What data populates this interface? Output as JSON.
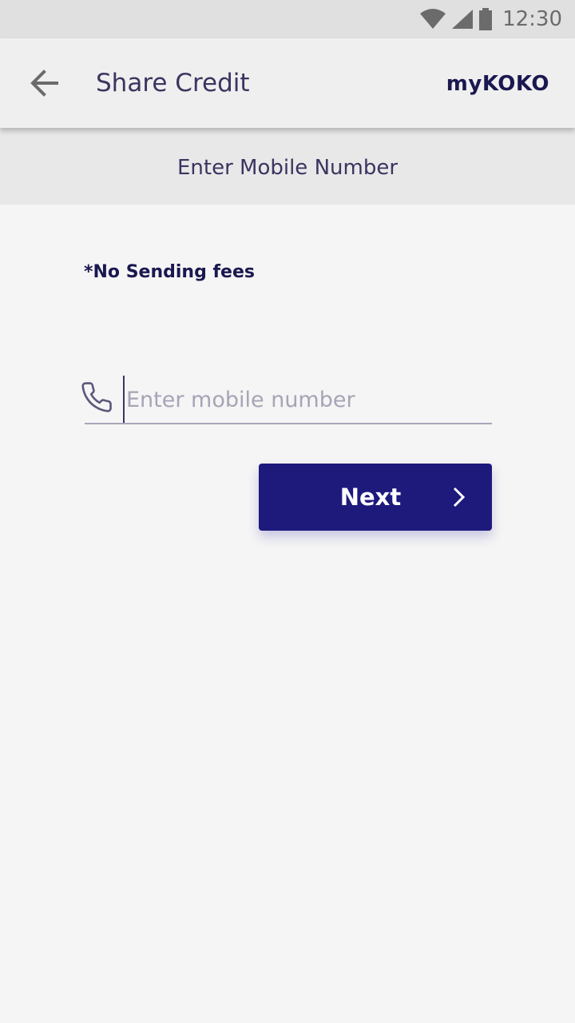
{
  "status_bar": {
    "time": "12:30",
    "icons": [
      "wifi-icon",
      "cellular-signal-icon",
      "battery-icon"
    ]
  },
  "app_bar": {
    "back_icon": "arrow-left-icon",
    "title": "Share Credit",
    "brand": "myKOKO"
  },
  "subheader": {
    "title": "Enter Mobile Number"
  },
  "form": {
    "note": "*No Sending fees",
    "phone_icon": "phone-icon",
    "phone_value": "",
    "phone_placeholder": "Enter mobile number",
    "next_label": "Next",
    "next_icon": "chevron-right-icon"
  },
  "colors": {
    "primary": "#1d1a7c",
    "title_text": "#3a3560",
    "background": "#f5f5f5",
    "app_bar": "#efefef",
    "subheader": "#e8e8e8",
    "status_bar": "#e0e0e0"
  }
}
